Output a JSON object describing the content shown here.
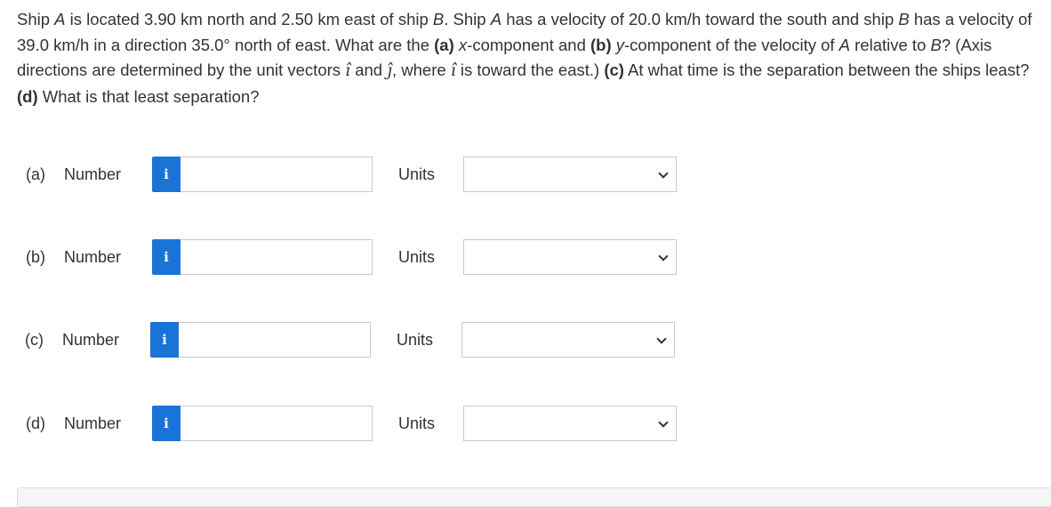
{
  "question": {
    "s1": "Ship ",
    "s2": "A",
    "s3": " is located 3.90 km north and 2.50 km east of ship ",
    "s4": "B",
    "s5": ". Ship ",
    "s6": "A",
    "s7": " has a velocity of 20.0 km/h toward the south and ship ",
    "s8": "B",
    "s9": " has a velocity of 39.0 km/h in a direction 35.0° north of east. What are the ",
    "s10": "(a)",
    "s11": " ",
    "s12": "x",
    "s13": "-component and ",
    "s14": "(b)",
    "s15": " ",
    "s16": "y",
    "s17": "-component of the velocity of ",
    "s18": "A",
    "s19": " relative to ",
    "s20": "B",
    "s21": "? (Axis directions are determined by the unit vectors ",
    "s22": "î",
    "s23": " and ",
    "s24": "ĵ",
    "s25": ", where ",
    "s26": "î",
    "s27": " is toward the east.) ",
    "s28": "(c)",
    "s29": " At what time is the separation between the ships least? ",
    "s30": "(d)",
    "s31": " What is that least separation?"
  },
  "answers": [
    {
      "part": "(a)",
      "number_label": "Number",
      "info": "i",
      "value": "",
      "units_label": "Units",
      "units_value": ""
    },
    {
      "part": "(b)",
      "number_label": "Number",
      "info": "i",
      "value": "",
      "units_label": "Units",
      "units_value": ""
    },
    {
      "part": "(c)",
      "number_label": "Number",
      "info": "i",
      "value": "",
      "units_label": "Units",
      "units_value": ""
    },
    {
      "part": "(d)",
      "number_label": "Number",
      "info": "i",
      "value": "",
      "units_label": "Units",
      "units_value": ""
    }
  ],
  "colors": {
    "info_button": "#1a73d6",
    "text": "#333333",
    "border": "#c9c9c9"
  }
}
